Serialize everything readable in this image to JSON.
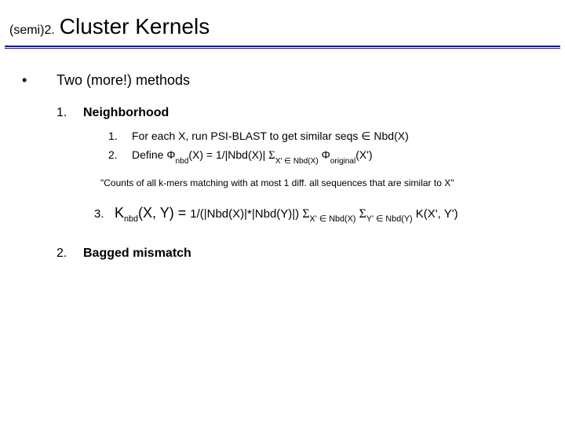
{
  "title": {
    "prefix": "(semi)2.",
    "main": "Cluster Kernels"
  },
  "lvl1": {
    "bullet": "•",
    "text": "Two (more!) methods"
  },
  "method1": {
    "num": "1.",
    "label": "Neighborhood",
    "step1": {
      "num": "1.",
      "text": "For each X, run PSI-BLAST to get similar seqs ∈ Nbd(X)"
    },
    "step2": {
      "num": "2.",
      "t0": "Define Φ",
      "s0": "nbd",
      "t1": "(X) = 1/|Nbd(X)| ",
      "sig1": "Σ",
      "s1": "X' ∈ Nbd(X)",
      "t2": " Φ",
      "s2": "original",
      "t3": "(X')"
    },
    "quote": "\"Counts of all k-mers matching with at most 1 diff. all sequences that are similar to X\"",
    "step3": {
      "num": "3.",
      "k0": "K",
      "ks0": "nbd",
      "k1": "(X, Y) = ",
      "t0": "1/(|Nbd(X)|*|Nbd(Y)|) ",
      "sig1": "Σ",
      "s1": "X' ∈ Nbd(X)",
      "sp": " ",
      "sig2": "Σ",
      "s2": "Y' ∈ Nbd(Y)",
      "t1": " K(X', Y')"
    }
  },
  "method2": {
    "num": "2.",
    "label": "Bagged mismatch"
  }
}
